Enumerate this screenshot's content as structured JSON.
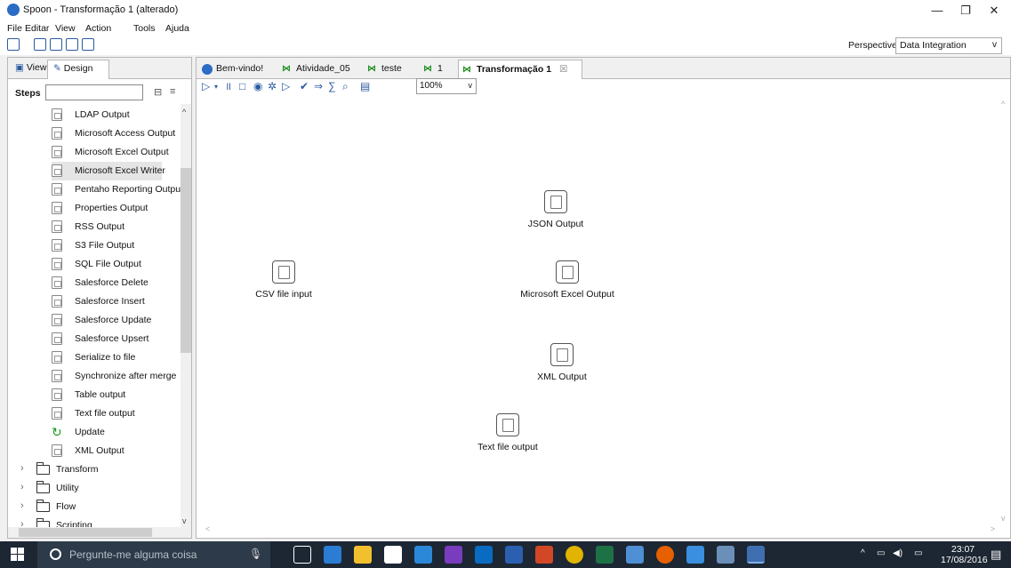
{
  "window": {
    "title": "Spoon - Transformação 1 (alterado)",
    "controls": [
      "—",
      "❐",
      "✕"
    ]
  },
  "menu": [
    "File",
    "Editar",
    "View",
    "Action",
    "Tools",
    "Ajuda"
  ],
  "perspective": {
    "label": "Perspective:",
    "value": "Data Integration"
  },
  "left_panel": {
    "tabs": [
      "View",
      "Design"
    ],
    "steps_label": "Steps",
    "steps_search_value": "",
    "items": [
      "LDAP Output",
      "Microsoft Access Output",
      "Microsoft Excel Output",
      "Microsoft Excel Writer",
      "Pentaho Reporting Output",
      "Properties Output",
      "RSS Output",
      "S3 File Output",
      "SQL File Output",
      "Salesforce Delete",
      "Salesforce Insert",
      "Salesforce Update",
      "Salesforce Upsert",
      "Serialize to file",
      "Synchronize after merge",
      "Table output",
      "Text file output",
      "Update",
      "XML Output"
    ],
    "selected_item": "Microsoft Excel Writer",
    "folders": [
      "Transform",
      "Utility",
      "Flow",
      "Scripting"
    ]
  },
  "editor": {
    "tabs": [
      {
        "label": "Bem-vindo!",
        "icon": "spoon-icon"
      },
      {
        "label": "Atividade_05",
        "icon": "transformation-icon"
      },
      {
        "label": "teste",
        "icon": "transformation-icon"
      },
      {
        "label": "1",
        "icon": "transformation-icon"
      },
      {
        "label": "Transformação 1",
        "icon": "transformation-icon",
        "active": true,
        "close": "☒"
      }
    ],
    "zoom": "100%",
    "canvas_nodes": [
      {
        "label": "JSON Output",
        "icon": "json-output-icon"
      },
      {
        "label": "CSV file input",
        "icon": "csv-file-input-icon"
      },
      {
        "label": "Microsoft Excel Output",
        "icon": "excel-output-icon"
      },
      {
        "label": "XML Output",
        "icon": "xml-output-icon"
      },
      {
        "label": "Text file output",
        "icon": "text-file-output-icon"
      }
    ]
  },
  "taskbar": {
    "search_placeholder": "Pergunte-me alguma coisa",
    "time": "23:07",
    "date": "17/08/2016"
  },
  "colors": {
    "taskbar": "#1c2733",
    "accent": "#2c5aa0",
    "selected": "#e5e5e5"
  }
}
